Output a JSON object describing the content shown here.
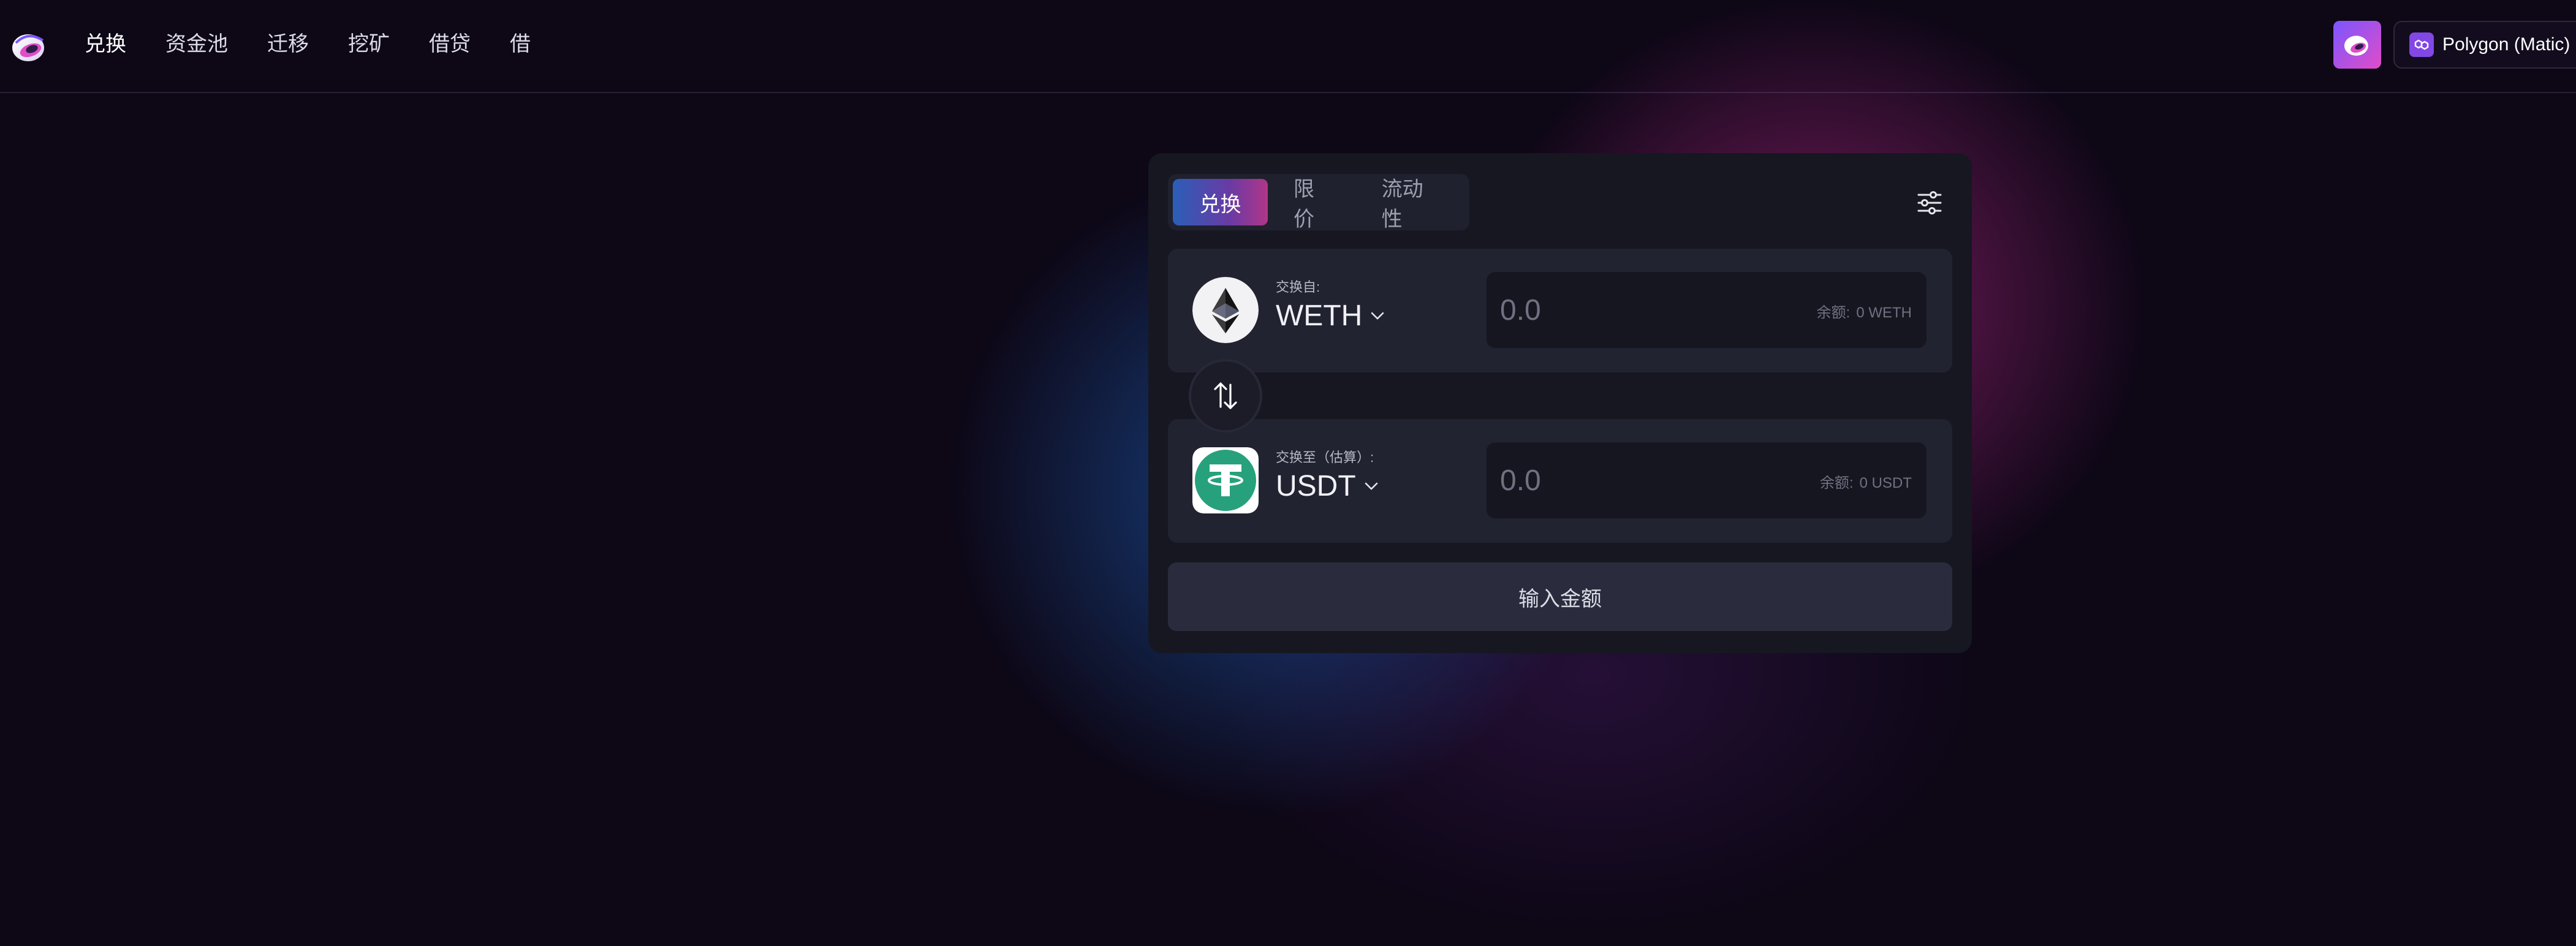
{
  "nav": {
    "items": [
      {
        "label": "兑换"
      },
      {
        "label": "资金池"
      },
      {
        "label": "迁移"
      },
      {
        "label": "挖矿"
      },
      {
        "label": "借贷"
      },
      {
        "label": "借"
      }
    ]
  },
  "header": {
    "network_label": "Polygon (Matic)",
    "network_icon": "polygon-icon",
    "avatar_icon": "app-avatar-icon"
  },
  "swap": {
    "tabs": [
      {
        "label": "兑换",
        "active": true
      },
      {
        "label": "限价",
        "active": false
      },
      {
        "label": "流动性",
        "active": false
      }
    ],
    "settings_icon": "sliders-icon",
    "from": {
      "caption": "交换自:",
      "token": "WETH",
      "token_icon": "ethereum-icon",
      "amount_placeholder": "0.0",
      "balance_label": "余额:",
      "balance_value": "0 WETH"
    },
    "to": {
      "caption": "交换至（估算）:",
      "token": "USDT",
      "token_icon": "tether-icon",
      "amount_placeholder": "0.0",
      "balance_label": "余额:",
      "balance_value": "0 USDT"
    },
    "toggle_icon": "swap-arrows-icon",
    "submit_label": "输入金额"
  },
  "colors": {
    "background": "#0d0716",
    "card": "#161721",
    "panel": "#222330",
    "accent_start": "#2a5fb8",
    "accent_end": "#b03689",
    "tether_green": "#26a17b"
  }
}
